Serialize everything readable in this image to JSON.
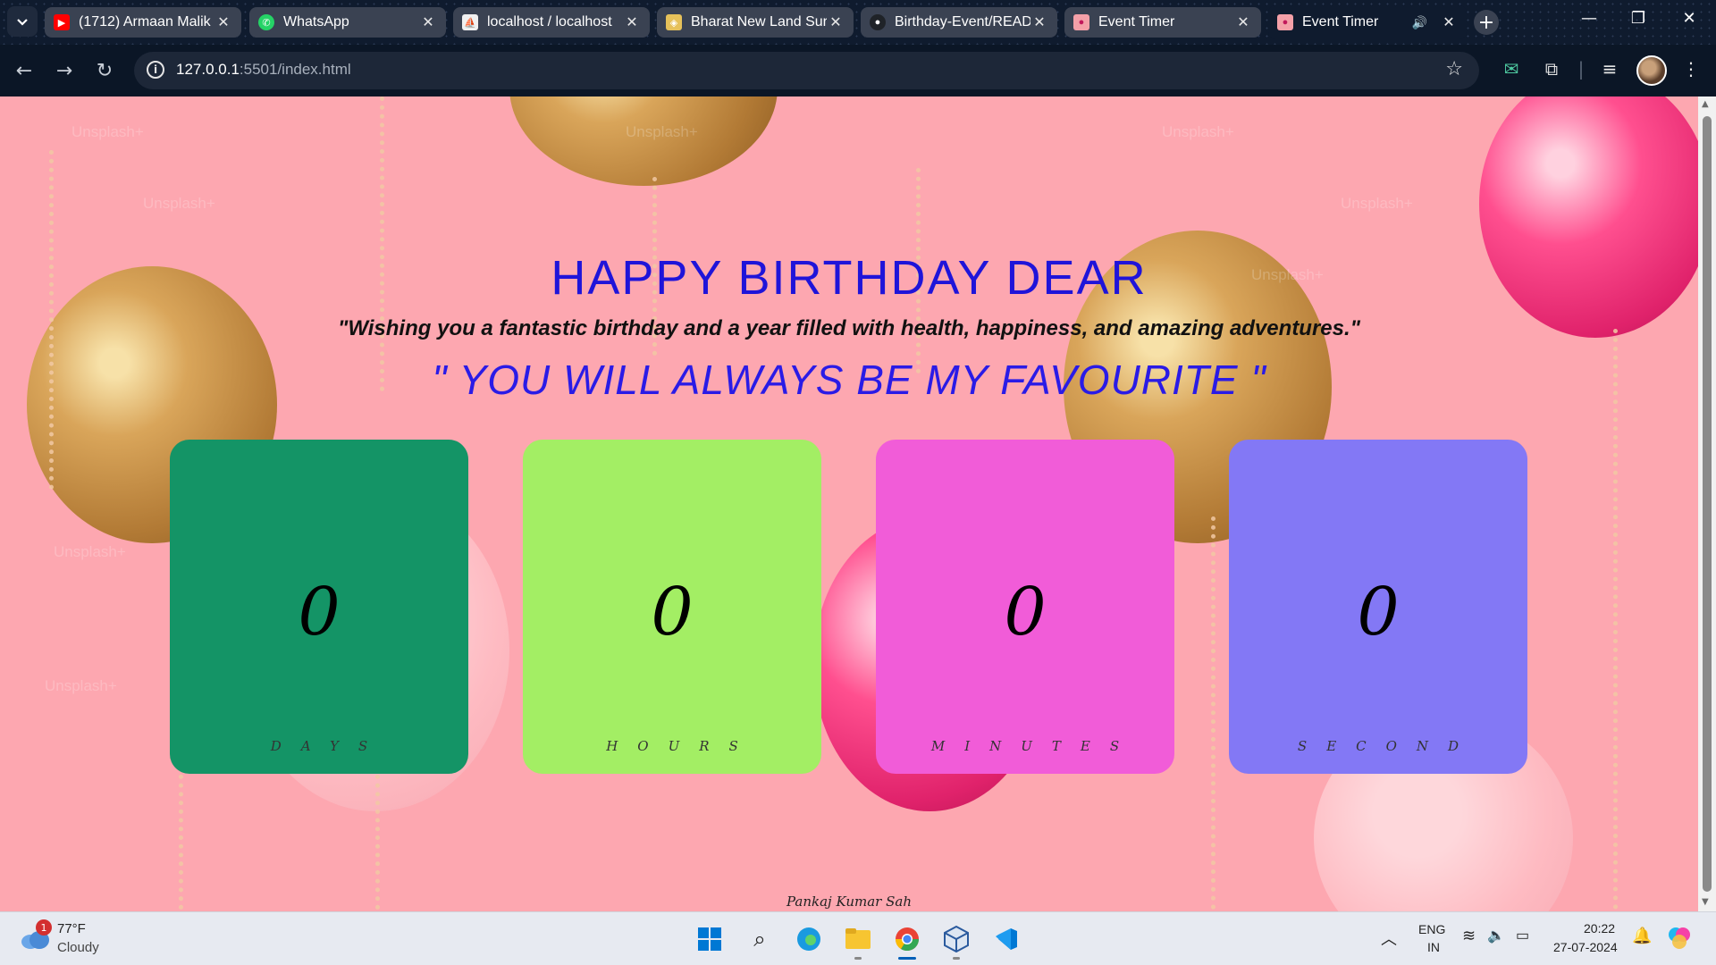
{
  "browser": {
    "tabs": [
      {
        "title": "(1712) Armaan Malik",
        "favicon": "youtube-icon",
        "color": "#ff0000",
        "active": false
      },
      {
        "title": "WhatsApp",
        "favicon": "whatsapp-icon",
        "color": "#25d366",
        "active": false
      },
      {
        "title": "localhost / localhost",
        "favicon": "phpmyadmin-icon",
        "color": "#f0f0f0",
        "active": false
      },
      {
        "title": "Bharat New Land Sur",
        "favicon": "map-icon",
        "color": "#e6c15a",
        "active": false
      },
      {
        "title": "Birthday-Event/READ",
        "favicon": "github-icon",
        "color": "#1f2328",
        "active": false
      },
      {
        "title": "Event Timer",
        "favicon": "balloon-icon",
        "color": "#f4a0a8",
        "active": false
      },
      {
        "title": "Event Timer",
        "favicon": "balloon-icon",
        "color": "#f4a0a8",
        "active": true
      }
    ],
    "url_host": "127.0.0.1",
    "url_rest": ":5501/index.html"
  },
  "page": {
    "title": "HAPPY BIRTHDAY DEAR",
    "wish": "\"Wishing you a fantastic birthday and a year filled with health, happiness, and amazing adventures.\"",
    "favourite": "\" YOU WILL ALWAYS BE MY FAVOURITE \"",
    "countdown": [
      {
        "value": "0",
        "label": "DAYS",
        "color": "#149466"
      },
      {
        "value": "0",
        "label": "HOURS",
        "color": "#a3ee64"
      },
      {
        "value": "0",
        "label": "MINUTES",
        "color": "#f15cd8"
      },
      {
        "value": "0",
        "label": "SECOND",
        "color": "#8378f5"
      }
    ],
    "credit": "Pankaj Kumar Sah",
    "watermark": "Unsplash+"
  },
  "taskbar": {
    "weather_temp": "77°F",
    "weather_cond": "Cloudy",
    "weather_badge": "1",
    "lang_top": "ENG",
    "lang_bottom": "IN",
    "time": "20:22",
    "date": "27-07-2024"
  }
}
